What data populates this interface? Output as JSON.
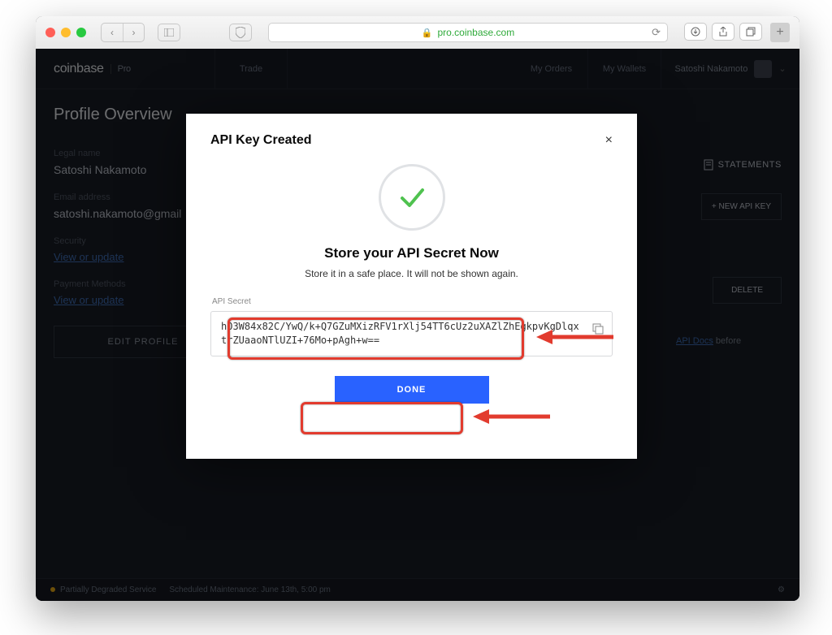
{
  "browser": {
    "url_host": "pro.coinbase.com"
  },
  "header": {
    "brand": "coinbase",
    "brand_sub": "Pro",
    "nav": {
      "trade": "Trade",
      "orders": "My Orders",
      "wallets": "My Wallets"
    },
    "user_name": "Satoshi Nakamoto"
  },
  "profile": {
    "title": "Profile Overview",
    "legal_name_label": "Legal name",
    "legal_name": "Satoshi Nakamoto",
    "email_label": "Email address",
    "email": "satoshi.nakamoto@gmail",
    "security_label": "Security",
    "view_update": "View or update",
    "payment_label": "Payment Methods",
    "edit_profile": "EDIT PROFILE"
  },
  "side": {
    "statements": "STATEMENTS",
    "new_api": "+ NEW API KEY",
    "delete": "DELETE",
    "docs_pre": "",
    "docs_link": "API Docs",
    "docs_post": " before"
  },
  "modal": {
    "title": "API Key Created",
    "close": "×",
    "heading": "Store your API Secret Now",
    "subtitle": "Store it in a safe place. It will not be shown again.",
    "secret_label": "API Secret",
    "secret_value": "hO3W84x82C/YwQ/k+Q7GZuMXizRFV1rXlj54TT6cUz2uXAZlZhEgkpvKgDlqxtrZUaaoNTlUZI+76Mo+pAgh+w==",
    "done": "DONE"
  },
  "footer": {
    "status": "Partially Degraded Service",
    "maint": "Scheduled Maintenance: June 13th, 5:00 pm"
  }
}
